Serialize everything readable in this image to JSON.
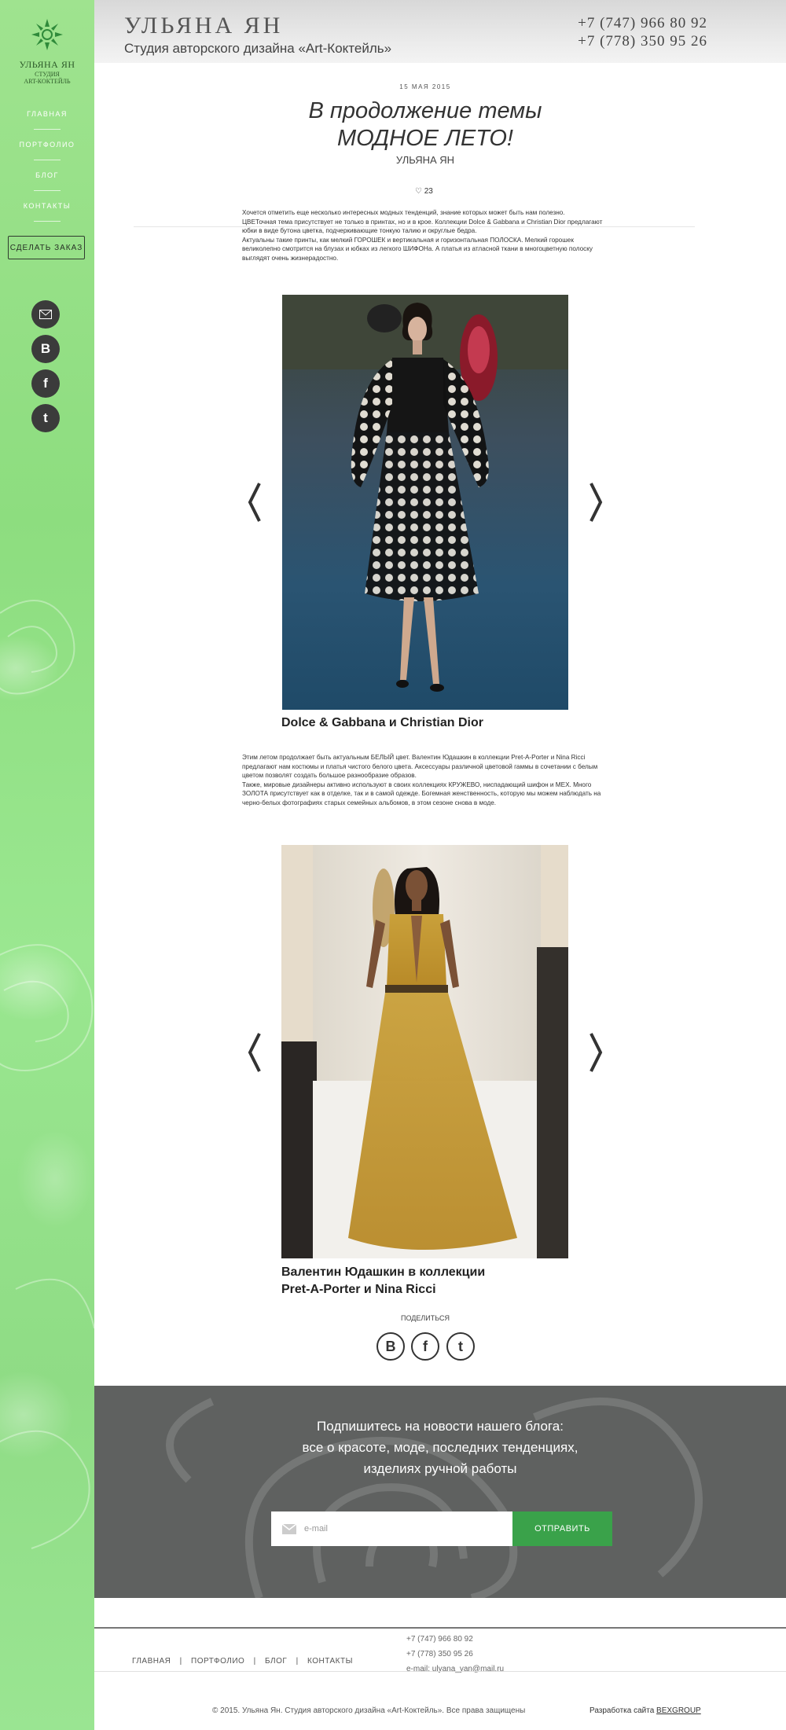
{
  "sidebar": {
    "logo_name": "УЛЬЯНА ЯН",
    "logo_sub1": "СТУДИЯ",
    "logo_sub2": "ART-КОКТЕЙЛЬ",
    "nav": [
      "ГЛАВНАЯ",
      "ПОРТФОЛИО",
      "БЛОГ",
      "КОНТАКТЫ"
    ],
    "order_label": "СДЕЛАТЬ ЗАКАЗ",
    "social_icons": [
      "mail-icon",
      "vk-icon",
      "facebook-icon",
      "twitter-icon"
    ]
  },
  "header": {
    "name": "УЛЬЯНА ЯН",
    "subtitle": "Студия авторского дизайна «Art-Коктейль»",
    "phone1": "+7 (747) 966 80 92",
    "phone2": "+7 (778) 350 95 26"
  },
  "article": {
    "date": "15 МАЯ 2015",
    "title_line1": "В продолжение темы",
    "title_line2": "МОДНОЕ ЛЕТО!",
    "author": "УЛЬЯНА ЯН",
    "likes": "23",
    "para1": [
      "Хочется отметить еще несколько интересных модных тенденций, знание которых может быть нам полезно.",
      " ЦВЕТочная тема присутствует не только в принтах, но и в крое. Коллекции Dolce & Gabbana и Christian Dior предлагают юбки в виде бутона цветка, подчеркивающие тонкую талию и округлые бедра.",
      " Актуальны такие принты, как мелкий ГОРОШЕК и вертикальная и горизонтальная ПОЛОСКА. Мелкий горошек великолепно смотрится на блузах и юбках из легкого ШИФОНа. А платья из атласной ткани в многоцветную полоску выглядят очень жизнерадостно."
    ],
    "caption1": "Dolce & Gabbana и Christian Dior",
    "para2": [
      "Этим летом продолжает быть актуальным БЕЛЫЙ цвет. Валентин Юдашкин в коллекции Pret-A-Porter и Nina Ricci предлагают нам костюмы и платья чистого белого цвета. Аксессуары различной цветовой гаммы в сочетании с белым цветом позволят создать большое разнообразие образов.",
      "Также, мировые дизайнеры активно используют в своих коллекциях КРУЖЕВО, ниспадающий шифон и МЕХ. Много ЗОЛОТА присутствует как в отделке, так и в самой одежде. Богемная женственность, которую мы можем наблюдать на черно-белых фотографиях старых семейных альбомов, в этом сезоне снова в моде."
    ],
    "caption2_line1": "Валентин Юдашкин в коллекции",
    "caption2_line2": "Pret-A-Porter и Nina Ricci",
    "share_label": "ПОДЕЛИТЬСЯ"
  },
  "subscribe": {
    "line1": "Подпишитесь на новости нашего блога:",
    "line2": "все о красоте, моде, последних тенденциях,",
    "line3": "изделиях ручной работы",
    "placeholder": "e-mail",
    "button": "ОТПРАВИТЬ"
  },
  "footer": {
    "nav": [
      "ГЛАВНАЯ",
      "ПОРТФОЛИО",
      "БЛОГ",
      "КОНТАКТЫ"
    ],
    "separator": "|",
    "phone1": "+7 (747) 966 80 92",
    "phone2": "+7 (778) 350 95 26",
    "email": "e-mail: ulyana_yan@mail.ru",
    "copyright": "© 2015. Ульяна Ян. Студия авторского дизайна «Art-Коктейль». Все права защищены",
    "dev_prefix": "Разработка сайта",
    "dev_link": "BEXGROUP"
  },
  "colors": {
    "sidebar_green": "#8ddd7f",
    "subscribe_bg": "#5f6160",
    "button_green": "#3aa24a"
  }
}
